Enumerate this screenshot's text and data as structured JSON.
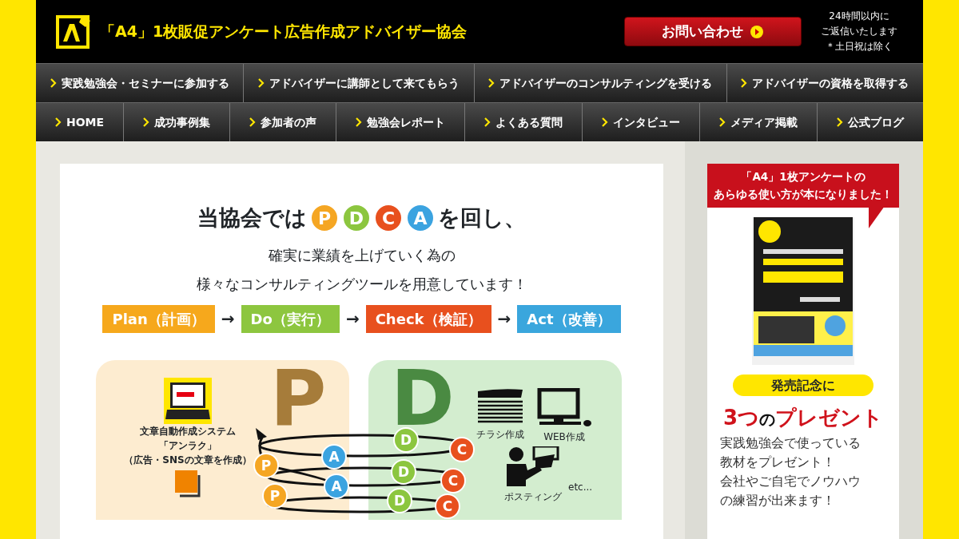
{
  "header": {
    "logo_text": "「A4」1枚販促アンケート広告作成アドバイザー協会",
    "contact_button": "お問い合わせ",
    "note_lines": [
      "24時間以内に",
      "ご返信いたします",
      "＊土日祝は除く"
    ]
  },
  "nav_rows": [
    [
      "実践勉強会・セミナーに参加する",
      "アドバイザーに講師として来てもらう",
      "アドバイザーのコンサルティングを受ける",
      "アドバイザーの資格を取得する"
    ],
    [
      "HOME",
      "成功事例集",
      "参加者の声",
      "勉強会レポート",
      "よくある質問",
      "インタビュー",
      "メディア掲載",
      "公式ブログ"
    ]
  ],
  "headline": {
    "before": "当協会では",
    "badges": [
      {
        "letter": "P",
        "color": "#f5a623"
      },
      {
        "letter": "D",
        "color": "#8cc63f"
      },
      {
        "letter": "C",
        "color": "#e8501e"
      },
      {
        "letter": "A",
        "color": "#3ba3e0"
      }
    ],
    "after": "を回し、"
  },
  "subtitle_lines": [
    "確実に業績を上げていく為の",
    "様々なコンサルティングツールを用意しています！"
  ],
  "steps": [
    {
      "label": "Plan（計画）",
      "color": "#f6a81c"
    },
    {
      "label": "Do（実行）",
      "color": "#8dc63f"
    },
    {
      "label": "Check（検証）",
      "color": "#e8501e"
    },
    {
      "label": "Act（改善）",
      "color": "#3aa6dd"
    }
  ],
  "step_arrow": "→",
  "diagram": {
    "panels": [
      {
        "letter": "P",
        "color": "#fdecd0",
        "captions": [
          "文章自動作成システム",
          "「アンラク」",
          "（広告・SNSの文章を作成）"
        ]
      },
      {
        "letter": "D",
        "color": "#d3edcf",
        "items": [
          "チラシ作成",
          "WEB作成",
          "ポスティング",
          "etc..."
        ]
      }
    ],
    "orbit_badges": [
      {
        "letter": "D",
        "color": "#8cc63f"
      },
      {
        "letter": "C",
        "color": "#e8501e"
      },
      {
        "letter": "A",
        "color": "#3ba3e0"
      },
      {
        "letter": "P",
        "color": "#f5a623"
      },
      {
        "letter": "D",
        "color": "#8cc63f"
      },
      {
        "letter": "C",
        "color": "#e8501e"
      },
      {
        "letter": "A",
        "color": "#3ba3e0"
      },
      {
        "letter": "P",
        "color": "#f5a623"
      },
      {
        "letter": "D",
        "color": "#8cc63f"
      },
      {
        "letter": "C",
        "color": "#e8501e"
      }
    ]
  },
  "sidebar": {
    "banner_lines": [
      "「A4」1枚アンケートの",
      "あらゆる使い方が本になりました！"
    ],
    "book": {
      "kind": "picture"
    },
    "pill": "発売記念に",
    "present_parts": [
      {
        "text": "3つ",
        "accent": true
      },
      {
        "text": "の",
        "accent": false
      },
      {
        "text": "プレゼント",
        "accent": true
      }
    ],
    "body_lines": [
      "実践勉強会で使っている",
      "教材をプレゼント！",
      "会社やご自宅でノウハウ",
      "の練習が出来ます！"
    ]
  }
}
